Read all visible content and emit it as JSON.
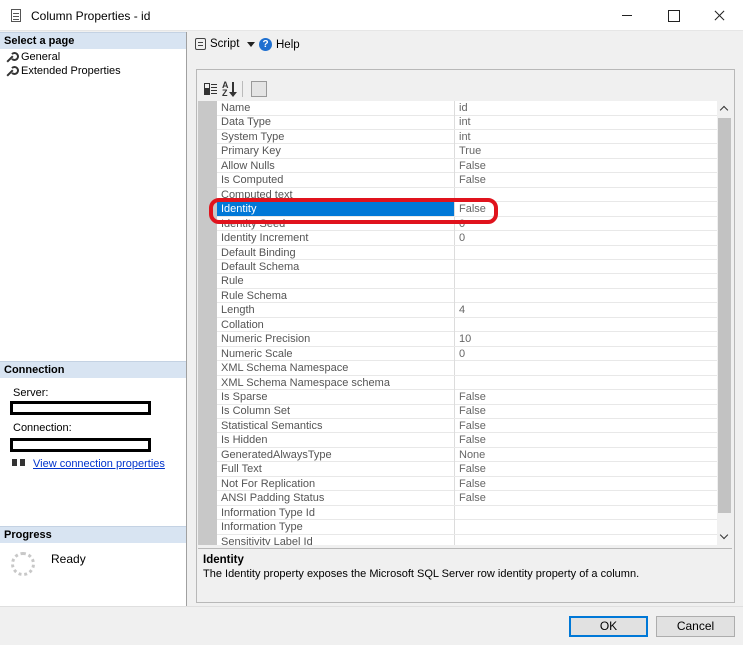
{
  "window": {
    "title": "Column Properties - id"
  },
  "left_panel": {
    "select_page_header": "Select a page",
    "pages": [
      {
        "label": "General"
      },
      {
        "label": "Extended Properties"
      }
    ],
    "connection_header": "Connection",
    "server_label": "Server:",
    "connection_label": "Connection:",
    "view_connection_link": "View connection properties",
    "progress_header": "Progress",
    "progress_status": "Ready"
  },
  "toolbar": {
    "script_label": "Script",
    "help_label": "Help"
  },
  "properties": [
    {
      "name": "Name",
      "value": "id"
    },
    {
      "name": "Data Type",
      "value": "int"
    },
    {
      "name": "System Type",
      "value": "int"
    },
    {
      "name": "Primary Key",
      "value": "True"
    },
    {
      "name": "Allow Nulls",
      "value": "False"
    },
    {
      "name": "Is Computed",
      "value": "False"
    },
    {
      "name": "Computed text",
      "value": ""
    },
    {
      "name": "Identity",
      "value": "False"
    },
    {
      "name": "Identity Seed",
      "value": "0"
    },
    {
      "name": "Identity Increment",
      "value": "0"
    },
    {
      "name": "Default Binding",
      "value": ""
    },
    {
      "name": "Default Schema",
      "value": ""
    },
    {
      "name": "Rule",
      "value": ""
    },
    {
      "name": "Rule Schema",
      "value": ""
    },
    {
      "name": "Length",
      "value": "4"
    },
    {
      "name": "Collation",
      "value": ""
    },
    {
      "name": "Numeric Precision",
      "value": "10"
    },
    {
      "name": "Numeric Scale",
      "value": "0"
    },
    {
      "name": "XML Schema Namespace",
      "value": ""
    },
    {
      "name": "XML Schema Namespace schema",
      "value": ""
    },
    {
      "name": "Is Sparse",
      "value": "False"
    },
    {
      "name": "Is Column Set",
      "value": "False"
    },
    {
      "name": "Statistical Semantics",
      "value": "False"
    },
    {
      "name": "Is Hidden",
      "value": "False"
    },
    {
      "name": "GeneratedAlwaysType",
      "value": "None"
    },
    {
      "name": "Full Text",
      "value": "False"
    },
    {
      "name": "Not For Replication",
      "value": "False"
    },
    {
      "name": "ANSI Padding Status",
      "value": "False"
    },
    {
      "name": "Information Type Id",
      "value": ""
    },
    {
      "name": "Information Type",
      "value": ""
    },
    {
      "name": "Sensitivity Label Id",
      "value": ""
    }
  ],
  "selected_property": "Identity",
  "description": {
    "title": "Identity",
    "text": "The Identity property exposes the Microsoft SQL Server row identity property of a column."
  },
  "buttons": {
    "ok": "OK",
    "cancel": "Cancel"
  },
  "colors": {
    "selection": "#0078d7",
    "annotation": "#e0131d",
    "section_header": "#d8e4f2"
  }
}
